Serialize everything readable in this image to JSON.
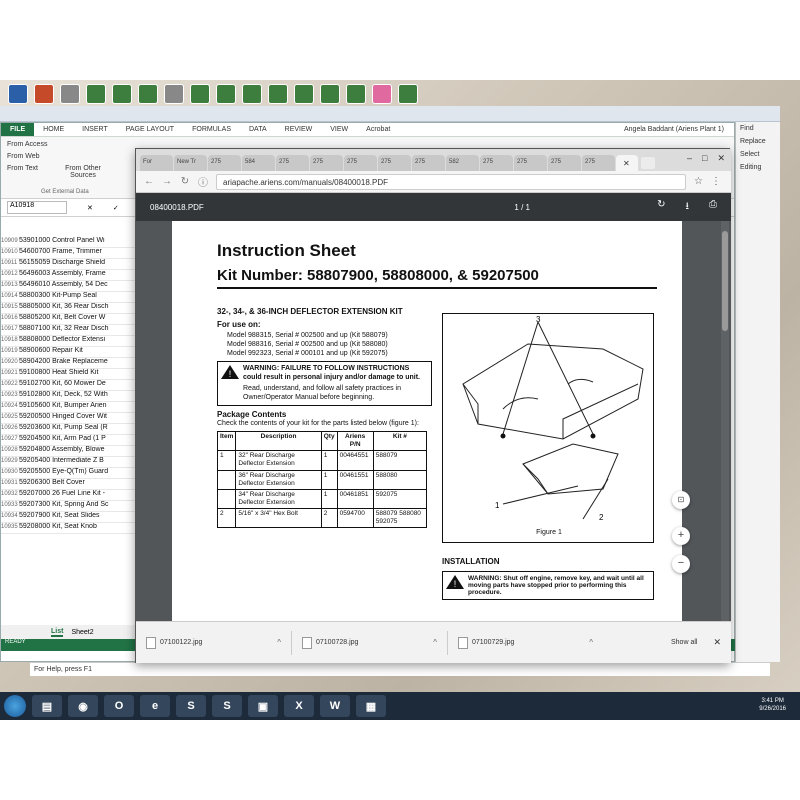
{
  "excel": {
    "tabs": [
      "FILE",
      "HOME",
      "INSERT",
      "PAGE LAYOUT",
      "FORMULAS",
      "DATA",
      "REVIEW",
      "VIEW",
      "Acrobat"
    ],
    "user": "Angela Baddant (Ariens Plant 1)",
    "ribbon": {
      "from_access": "From Access",
      "from_web": "From Web",
      "from_text": "From Text",
      "from_other": "From Other Sources",
      "group": "Get External Data"
    },
    "name_box": "A10918",
    "rows": [
      {
        "n": "10909",
        "t": "53901000 Control Panel Wi"
      },
      {
        "n": "10910",
        "t": "54600700 Frame, Trimmer"
      },
      {
        "n": "10911",
        "t": "56155059 Discharge Shield"
      },
      {
        "n": "10912",
        "t": "56496003 Assembly, Frame"
      },
      {
        "n": "10913",
        "t": "56496010 Assembly, 54 Dec"
      },
      {
        "n": "10914",
        "t": "58800300 Kit-Pump Seal"
      },
      {
        "n": "10915",
        "t": "58805000 Kit, 36 Rear Disch"
      },
      {
        "n": "10916",
        "t": "58805200 Kit, Belt Cover W"
      },
      {
        "n": "10917",
        "t": "58807100 Kit, 32 Rear Disch"
      },
      {
        "n": "10918",
        "t": "58808000 Deflector Extensi"
      },
      {
        "n": "10919",
        "t": "58900600 Repair Kit"
      },
      {
        "n": "10920",
        "t": "58904200 Brake Replaceme"
      },
      {
        "n": "10921",
        "t": "59100800 Heat Shield Kit"
      },
      {
        "n": "10922",
        "t": "59102700 Kit, 60 Mower De"
      },
      {
        "n": "10923",
        "t": "59102800 Kit, Deck, 52 With"
      },
      {
        "n": "10924",
        "t": "59105600 Kit, Bumper Arien"
      },
      {
        "n": "10925",
        "t": "59200500 Hinged Cover Wit"
      },
      {
        "n": "10926",
        "t": "59203600 Kit, Pump Seal (R"
      },
      {
        "n": "10927",
        "t": "59204500 Kit, Arm Pad (1 P"
      },
      {
        "n": "10928",
        "t": "59204800 Assembly, Blowe"
      },
      {
        "n": "10929",
        "t": "59205400 Intermediate Z B"
      },
      {
        "n": "10930",
        "t": "59205500 Eye-Q(Tm) Guard"
      },
      {
        "n": "10931",
        "t": "59206300 Belt Cover"
      },
      {
        "n": "10932",
        "t": "59207000 26 Fuel Line Kit -"
      },
      {
        "n": "10933",
        "t": "59207300 Kit, Spring And Sc"
      },
      {
        "n": "10934",
        "t": "59207900 Kit, Seat Slides"
      },
      {
        "n": "10935",
        "t": "59208000 Kit, Seat Knob"
      }
    ],
    "sheet_tabs": [
      "List",
      "Sheet2"
    ],
    "status": "READY",
    "help": "For Help, press F1"
  },
  "word_right": [
    "Find",
    "Replace",
    "Select",
    "Editing"
  ],
  "chrome": {
    "tabs": [
      "For",
      "New Tr",
      "275",
      "584",
      "275",
      "275",
      "275",
      "275",
      "275",
      "582",
      "275",
      "275",
      "275",
      "275"
    ],
    "url": "ariapache.ariens.com/manuals/08400018.PDF",
    "pdf_filename": "08400018.PDF",
    "page_indicator": "1 / 1",
    "downloads": [
      "07100122.jpg",
      "07100728.jpg",
      "07100729.jpg"
    ],
    "show_all": "Show all"
  },
  "pdf": {
    "title": "Instruction Sheet",
    "kit_number": "Kit Number: 58807900, 58808000, & 59207500",
    "subtitle": "32-, 34-, & 36-INCH DEFLECTOR EXTENSION KIT",
    "for_use_on": "For use on:",
    "models": [
      "Model 988315, Serial # 002500 and up (Kit 588079)",
      "Model 988316, Serial # 002500 and up (Kit 588080)",
      "Model 992323, Serial # 000101 and up (Kit 592075)"
    ],
    "warning1": "WARNING: FAILURE TO FOLLOW INSTRUCTIONS could result in personal injury and/or damage to unit.",
    "warning1_sub": "Read, understand, and follow all safety practices in Owner/Operator Manual before beginning.",
    "package_head": "Package Contents",
    "package_text": "Check the contents of your kit for the parts listed below (figure 1):",
    "table_headers": [
      "Item",
      "Description",
      "Qty",
      "Ariens P/N",
      "Kit #"
    ],
    "table_rows": [
      {
        "item": "1",
        "desc": "32\" Rear Discharge Deflector Extension",
        "qty": "1",
        "pn": "00464551",
        "kit": "588079"
      },
      {
        "item": "",
        "desc": "36\" Rear Discharge Deflector Extension",
        "qty": "1",
        "pn": "00461551",
        "kit": "588080"
      },
      {
        "item": "",
        "desc": "34\" Rear Discharge Deflector Extension",
        "qty": "1",
        "pn": "00461851",
        "kit": "592075"
      },
      {
        "item": "2",
        "desc": "5/16\" x 3/4\" Hex Bolt",
        "qty": "2",
        "pn": "0594700",
        "kit": "588079 588080 592075"
      }
    ],
    "figure_caption": "Figure 1",
    "callouts": [
      "3",
      "1",
      "2"
    ],
    "installation": "INSTALLATION",
    "warning2": "WARNING: Shut off engine, remove key, and wait until all moving parts have stopped prior to performing this procedure."
  },
  "taskbar": {
    "time": "3:41 PM",
    "date": "9/26/2016"
  }
}
